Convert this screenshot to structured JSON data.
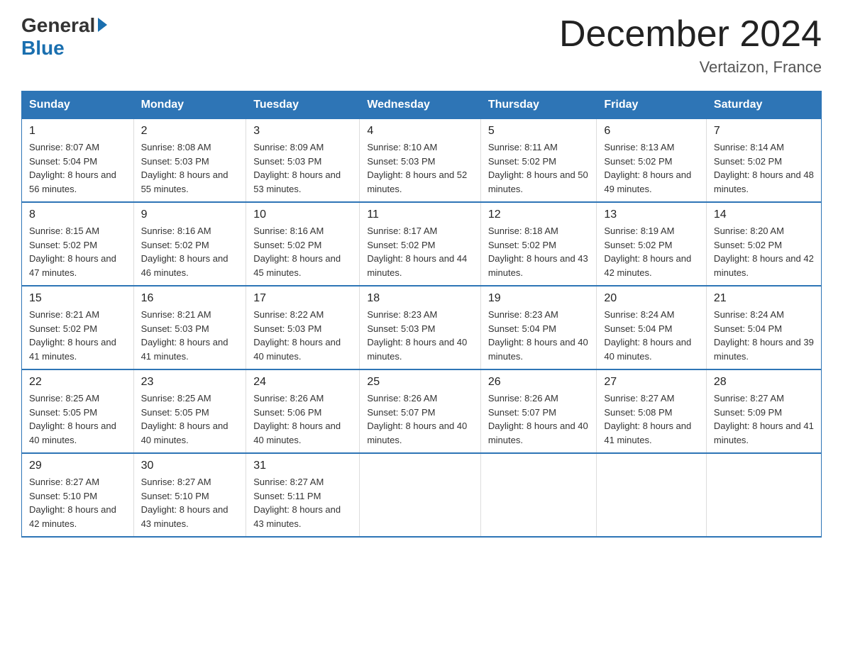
{
  "header": {
    "logo": {
      "general": "General",
      "blue": "Blue",
      "arrow": "▶"
    },
    "title": "December 2024",
    "location": "Vertaizon, France"
  },
  "calendar": {
    "days_of_week": [
      "Sunday",
      "Monday",
      "Tuesday",
      "Wednesday",
      "Thursday",
      "Friday",
      "Saturday"
    ],
    "weeks": [
      [
        {
          "day": "1",
          "sunrise": "8:07 AM",
          "sunset": "5:04 PM",
          "daylight": "8 hours and 56 minutes."
        },
        {
          "day": "2",
          "sunrise": "8:08 AM",
          "sunset": "5:03 PM",
          "daylight": "8 hours and 55 minutes."
        },
        {
          "day": "3",
          "sunrise": "8:09 AM",
          "sunset": "5:03 PM",
          "daylight": "8 hours and 53 minutes."
        },
        {
          "day": "4",
          "sunrise": "8:10 AM",
          "sunset": "5:03 PM",
          "daylight": "8 hours and 52 minutes."
        },
        {
          "day": "5",
          "sunrise": "8:11 AM",
          "sunset": "5:02 PM",
          "daylight": "8 hours and 50 minutes."
        },
        {
          "day": "6",
          "sunrise": "8:13 AM",
          "sunset": "5:02 PM",
          "daylight": "8 hours and 49 minutes."
        },
        {
          "day": "7",
          "sunrise": "8:14 AM",
          "sunset": "5:02 PM",
          "daylight": "8 hours and 48 minutes."
        }
      ],
      [
        {
          "day": "8",
          "sunrise": "8:15 AM",
          "sunset": "5:02 PM",
          "daylight": "8 hours and 47 minutes."
        },
        {
          "day": "9",
          "sunrise": "8:16 AM",
          "sunset": "5:02 PM",
          "daylight": "8 hours and 46 minutes."
        },
        {
          "day": "10",
          "sunrise": "8:16 AM",
          "sunset": "5:02 PM",
          "daylight": "8 hours and 45 minutes."
        },
        {
          "day": "11",
          "sunrise": "8:17 AM",
          "sunset": "5:02 PM",
          "daylight": "8 hours and 44 minutes."
        },
        {
          "day": "12",
          "sunrise": "8:18 AM",
          "sunset": "5:02 PM",
          "daylight": "8 hours and 43 minutes."
        },
        {
          "day": "13",
          "sunrise": "8:19 AM",
          "sunset": "5:02 PM",
          "daylight": "8 hours and 42 minutes."
        },
        {
          "day": "14",
          "sunrise": "8:20 AM",
          "sunset": "5:02 PM",
          "daylight": "8 hours and 42 minutes."
        }
      ],
      [
        {
          "day": "15",
          "sunrise": "8:21 AM",
          "sunset": "5:02 PM",
          "daylight": "8 hours and 41 minutes."
        },
        {
          "day": "16",
          "sunrise": "8:21 AM",
          "sunset": "5:03 PM",
          "daylight": "8 hours and 41 minutes."
        },
        {
          "day": "17",
          "sunrise": "8:22 AM",
          "sunset": "5:03 PM",
          "daylight": "8 hours and 40 minutes."
        },
        {
          "day": "18",
          "sunrise": "8:23 AM",
          "sunset": "5:03 PM",
          "daylight": "8 hours and 40 minutes."
        },
        {
          "day": "19",
          "sunrise": "8:23 AM",
          "sunset": "5:04 PM",
          "daylight": "8 hours and 40 minutes."
        },
        {
          "day": "20",
          "sunrise": "8:24 AM",
          "sunset": "5:04 PM",
          "daylight": "8 hours and 40 minutes."
        },
        {
          "day": "21",
          "sunrise": "8:24 AM",
          "sunset": "5:04 PM",
          "daylight": "8 hours and 39 minutes."
        }
      ],
      [
        {
          "day": "22",
          "sunrise": "8:25 AM",
          "sunset": "5:05 PM",
          "daylight": "8 hours and 40 minutes."
        },
        {
          "day": "23",
          "sunrise": "8:25 AM",
          "sunset": "5:05 PM",
          "daylight": "8 hours and 40 minutes."
        },
        {
          "day": "24",
          "sunrise": "8:26 AM",
          "sunset": "5:06 PM",
          "daylight": "8 hours and 40 minutes."
        },
        {
          "day": "25",
          "sunrise": "8:26 AM",
          "sunset": "5:07 PM",
          "daylight": "8 hours and 40 minutes."
        },
        {
          "day": "26",
          "sunrise": "8:26 AM",
          "sunset": "5:07 PM",
          "daylight": "8 hours and 40 minutes."
        },
        {
          "day": "27",
          "sunrise": "8:27 AM",
          "sunset": "5:08 PM",
          "daylight": "8 hours and 41 minutes."
        },
        {
          "day": "28",
          "sunrise": "8:27 AM",
          "sunset": "5:09 PM",
          "daylight": "8 hours and 41 minutes."
        }
      ],
      [
        {
          "day": "29",
          "sunrise": "8:27 AM",
          "sunset": "5:10 PM",
          "daylight": "8 hours and 42 minutes."
        },
        {
          "day": "30",
          "sunrise": "8:27 AM",
          "sunset": "5:10 PM",
          "daylight": "8 hours and 43 minutes."
        },
        {
          "day": "31",
          "sunrise": "8:27 AM",
          "sunset": "5:11 PM",
          "daylight": "8 hours and 43 minutes."
        },
        null,
        null,
        null,
        null
      ]
    ],
    "labels": {
      "sunrise": "Sunrise:",
      "sunset": "Sunset:",
      "daylight": "Daylight:"
    }
  }
}
